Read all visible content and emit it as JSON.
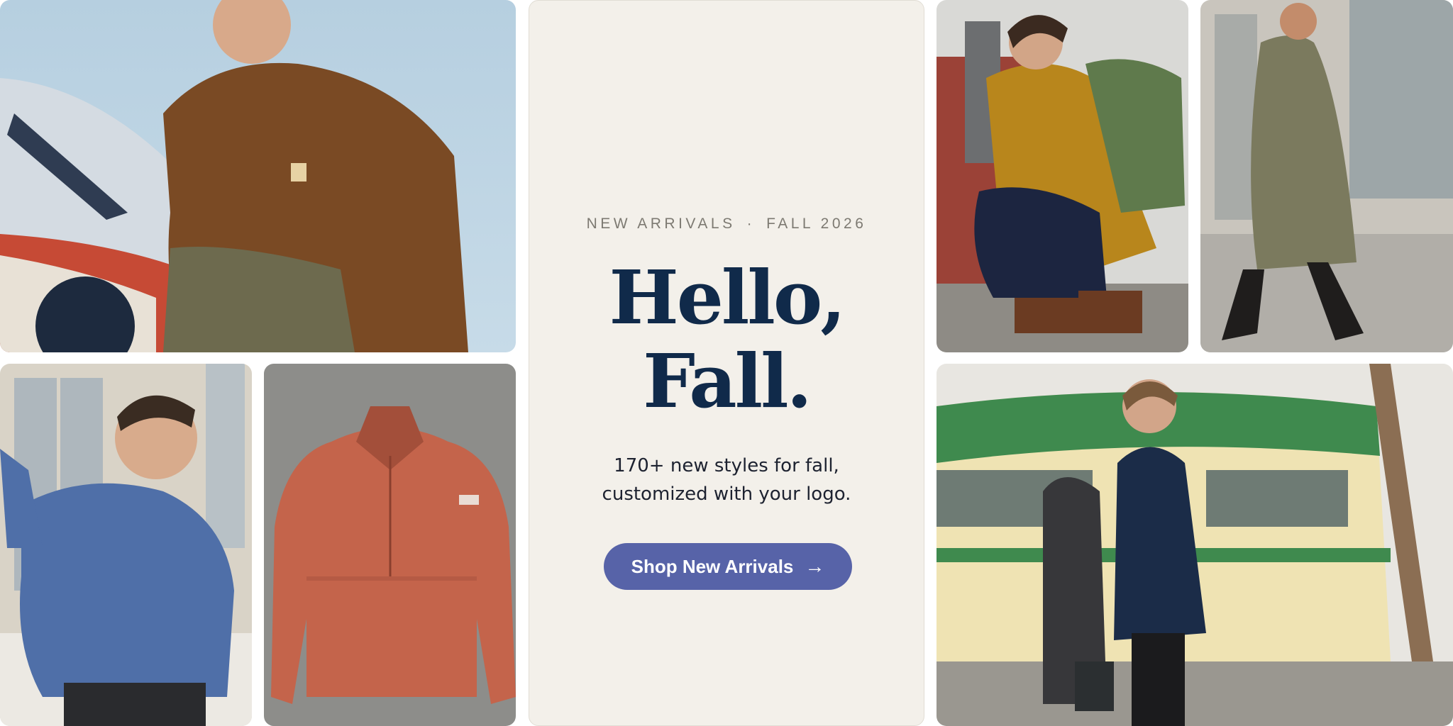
{
  "hero": {
    "eyebrow_left": "NEW ARRIVALS",
    "eyebrow_separator": "·",
    "eyebrow_right": "FALL 2026",
    "headline_line1": "Hello,",
    "headline_line2": "Fall.",
    "subtext_line1": "170+ new styles for fall,",
    "subtext_line2": "customized with your logo.",
    "cta_label": "Shop New Arrivals",
    "cta_icon": "arrow-right-icon"
  },
  "photos": [
    {
      "name": "photo-man-brown-jacket-race-car",
      "garment_color": "#7a4a24"
    },
    {
      "name": "photo-man-blue-quarter-zip",
      "garment_color": "#4f6fa8"
    },
    {
      "name": "photo-rust-fleece-pullover",
      "garment_color": "#c4644b"
    },
    {
      "name": "photo-man-mustard-jacket-backpack",
      "garment_color": "#b8861c"
    },
    {
      "name": "photo-woman-olive-long-coat",
      "garment_color": "#7b7a5e"
    },
    {
      "name": "photo-man-navy-jacket-streetcar",
      "garment_color": "#1b2c48"
    }
  ],
  "colors": {
    "hero_background": "#f3f0ea",
    "headline": "#102a4a",
    "cta_background": "#5763a8",
    "cta_text": "#ffffff"
  }
}
